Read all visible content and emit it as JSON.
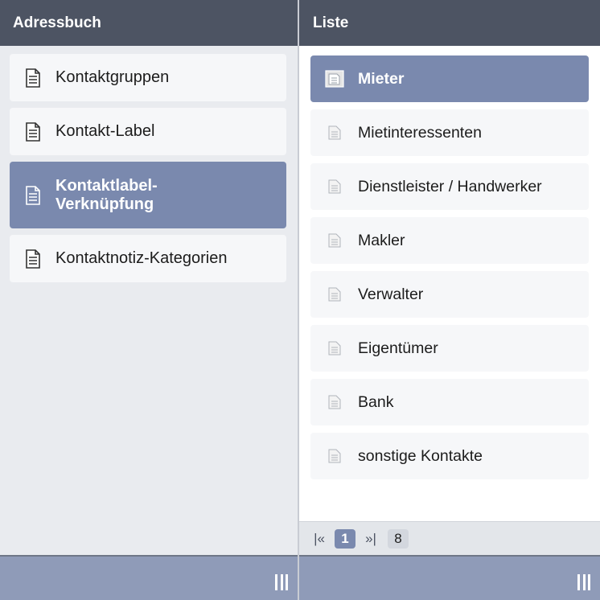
{
  "left_pane": {
    "title": "Adressbuch",
    "items": [
      {
        "label": "Kontaktgruppen",
        "icon": "document-icon",
        "selected": false
      },
      {
        "label": "Kontakt-Label",
        "icon": "document-icon",
        "selected": false
      },
      {
        "label": "Kontaktlabel-\nVerknüpfung",
        "icon": "document-icon",
        "selected": true
      },
      {
        "label": "Kontaktnotiz-Kategorien",
        "icon": "document-icon",
        "selected": false
      }
    ]
  },
  "right_pane": {
    "title": "Liste",
    "items": [
      {
        "label": "Mieter",
        "icon": "document-icon",
        "selected": true
      },
      {
        "label": "Mietinteressenten",
        "icon": "document-icon",
        "selected": false
      },
      {
        "label": "Dienstleister / Handwerker",
        "icon": "document-icon",
        "selected": false
      },
      {
        "label": "Makler",
        "icon": "document-icon",
        "selected": false
      },
      {
        "label": "Verwalter",
        "icon": "document-icon",
        "selected": false
      },
      {
        "label": "Eigentümer",
        "icon": "document-icon",
        "selected": false
      },
      {
        "label": "Bank",
        "icon": "document-icon",
        "selected": false
      },
      {
        "label": "sonstige Kontakte",
        "icon": "document-icon",
        "selected": false
      }
    ],
    "pager": {
      "first": "|«",
      "current": "1",
      "last": "»|",
      "total": "8"
    }
  },
  "colors": {
    "header_bg": "#4d5463",
    "selected_bg": "#7a89ae",
    "footer_bg": "#8f9bb8"
  }
}
